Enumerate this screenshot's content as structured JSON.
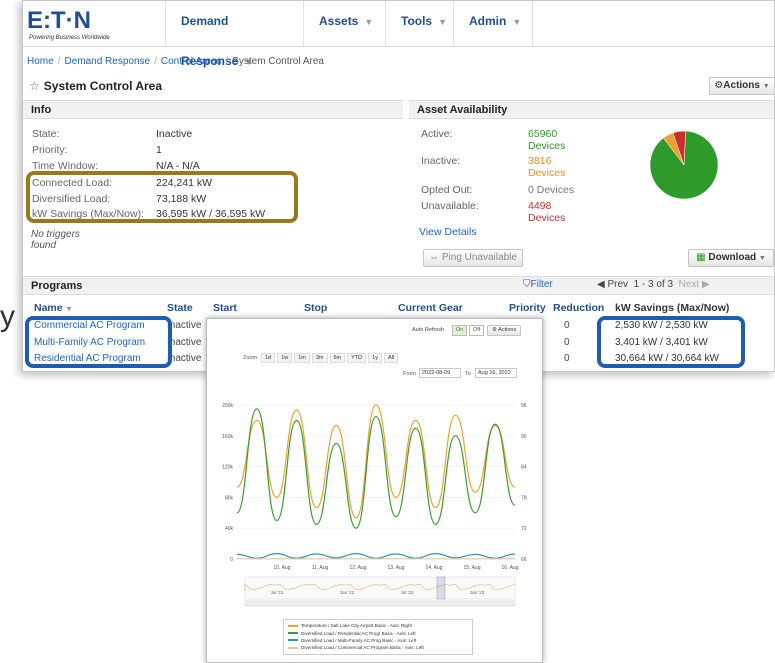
{
  "brand": {
    "name": "E:T·N",
    "tagline": "Powering Business Worldwide",
    "color": "#1d4f91"
  },
  "nav": [
    {
      "label": "Demand Response"
    },
    {
      "label": "Assets"
    },
    {
      "label": "Tools"
    },
    {
      "label": "Admin"
    }
  ],
  "breadcrumb": [
    "Home",
    "Demand Response",
    "Control Areas",
    "System Control Area"
  ],
  "page_title": "System Control Area",
  "actions_label": "Actions",
  "info": {
    "heading": "Info",
    "rows": [
      {
        "label": "State:",
        "value": "Inactive"
      },
      {
        "label": "Priority:",
        "value": "1"
      },
      {
        "label": "Time Window:",
        "value": "N/A - N/A"
      },
      {
        "label": "Connected Load:",
        "value": "224,241 kW"
      },
      {
        "label": "Diversified Load:",
        "value": "73,188 kW"
      },
      {
        "label": "kW Savings (Max/Now):",
        "value": "36,595 kW / 36,595 kW"
      }
    ],
    "no_triggers": "No triggers found"
  },
  "asset": {
    "heading": "Asset Availability",
    "rows": [
      {
        "label": "Active:",
        "count": "65960",
        "unit": "Devices",
        "color": "#2e9a2a"
      },
      {
        "label": "Inactive:",
        "count": "3816",
        "unit": "Devices",
        "color": "#ef8b26"
      },
      {
        "label": "Opted Out:",
        "count": "0 Devices",
        "unit": "",
        "color": "#777777"
      },
      {
        "label": "Unavailable:",
        "count": "4498",
        "unit": "Devices",
        "color": "#c9302c"
      }
    ],
    "view_details": "View Details",
    "ping_label": "Ping Unavailable",
    "download_label": "Download",
    "pie": [
      {
        "name": "Active",
        "value": 65960,
        "color": "#2e9a2a"
      },
      {
        "name": "Inactive",
        "value": 3816,
        "color": "#f0a030"
      },
      {
        "name": "Opted Out",
        "value": 0,
        "color": "#999999"
      },
      {
        "name": "Unavailable",
        "value": 4498,
        "color": "#c9302c"
      }
    ]
  },
  "programs": {
    "heading": "Programs",
    "filter_label": "Filter",
    "pager": {
      "prev": "Prev",
      "range": "1 - 3 of 3",
      "next": "Next"
    },
    "columns": [
      "Name",
      "State",
      "Start",
      "Stop",
      "Current Gear",
      "Priority",
      "Reduction",
      "kW Savings (Max/Now)"
    ],
    "rows": [
      {
        "name": "Commercial AC Program",
        "state": "Inactive",
        "savings": "2,530 kW / 2,530 kW"
      },
      {
        "name": "Multi-Family AC Program",
        "state": "Inactive",
        "savings": "3,401 kW / 3,401 kW"
      },
      {
        "name": "Residential AC Program",
        "state": "Inactive",
        "savings": "30,664 kW / 30,664 kW"
      }
    ],
    "reduction_value": "0"
  },
  "chart_popup": {
    "auto_refresh_label": "Auto Refresh",
    "on_label": "On",
    "off_label": "Off",
    "actions_label": "Actions",
    "zoom_label": "Zoom",
    "zoom_buttons": [
      "1d",
      "1w",
      "1m",
      "3m",
      "6m",
      "YTD",
      "1y",
      "All"
    ],
    "from_label": "From",
    "from_value": "2022-08-09",
    "to_label": "To",
    "to_value": "Aug 16, 2022",
    "navigator_labels": [
      "Jul '21",
      "Jan '22",
      "Jul '22",
      "Jan '23"
    ]
  },
  "chart_data": {
    "type": "line",
    "x": [
      "10. Aug",
      "11. Aug",
      "12. Aug",
      "13. Aug",
      "14. Aug",
      "15. Aug",
      "16. Aug"
    ],
    "ylim_left": [
      0,
      200000
    ],
    "yticks_left": [
      "0",
      "40k",
      "80k",
      "120k",
      "160k",
      "200k"
    ],
    "ylim_right": [
      66,
      96
    ],
    "yticks_right": [
      "66",
      "72",
      "78",
      "84",
      "90",
      "96"
    ],
    "series": [
      {
        "name": "Temperature / Salt Lake City Airport Basic - Axis: Right",
        "color": "#f0a030",
        "axis": "right",
        "values": [
          80,
          93,
          78,
          95,
          76,
          92,
          74,
          96,
          78,
          93,
          76,
          94,
          79,
          92,
          80
        ]
      },
      {
        "name": "Diversified Load / Residential AC Progr Basic - Axis: Left",
        "color": "#3a9d2e",
        "axis": "left",
        "values": [
          60000,
          195000,
          50000,
          180000,
          45000,
          150000,
          40000,
          185000,
          55000,
          170000,
          45000,
          160000,
          60000,
          175000,
          70000
        ]
      },
      {
        "name": "Diversified Load / Multi-Family AC Prog Basic - Axis: Left",
        "color": "#2a9aa8",
        "axis": "left",
        "values": [
          6000,
          1000,
          7000,
          1000,
          6500,
          1500,
          7000,
          1000,
          6500,
          1000,
          7000,
          1500,
          6000,
          1000,
          6500
        ]
      },
      {
        "name": "Diversified Load / Commercial AC Program Basic - Axis: Left",
        "color": "#e8c89a",
        "axis": "left",
        "values": [
          300,
          200,
          300,
          200,
          300,
          200,
          300,
          200,
          300,
          200,
          300,
          200,
          300,
          200,
          300
        ]
      }
    ]
  }
}
